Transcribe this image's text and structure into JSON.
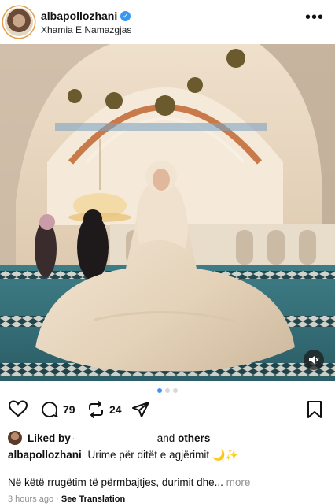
{
  "post": {
    "username": "albapollozhani",
    "location": "Xhamia E Namazgjas",
    "verified_icon": "verified-badge-icon",
    "more_icon": "more-options-icon"
  },
  "media": {
    "description_icon": "photo",
    "carousel_index": 1,
    "carousel_count": 3,
    "mute_icon": "speaker-muted-icon"
  },
  "actions": {
    "like_icon": "heart-icon",
    "comment_icon": "comment-icon",
    "comment_count": "79",
    "repost_icon": "repost-icon",
    "repost_count": "24",
    "share_icon": "send-icon",
    "save_icon": "bookmark-icon"
  },
  "likes": {
    "prefix": "Liked by",
    "hidden_name": "·",
    "suffix_and": "and",
    "suffix_others": "others"
  },
  "caption": {
    "username": "albapollozhani",
    "text": "Urime për ditët e agjërimit 🌙✨",
    "second_line": "Në këtë rrugëtim të përmbajtjes, durimit dhe...",
    "more_label": "more"
  },
  "meta": {
    "time_ago": "3 hours ago",
    "separator": "·",
    "translation_label": "See Translation"
  },
  "colors": {
    "accent_blue": "#3897f0",
    "muted_text": "#8e8e8e"
  }
}
